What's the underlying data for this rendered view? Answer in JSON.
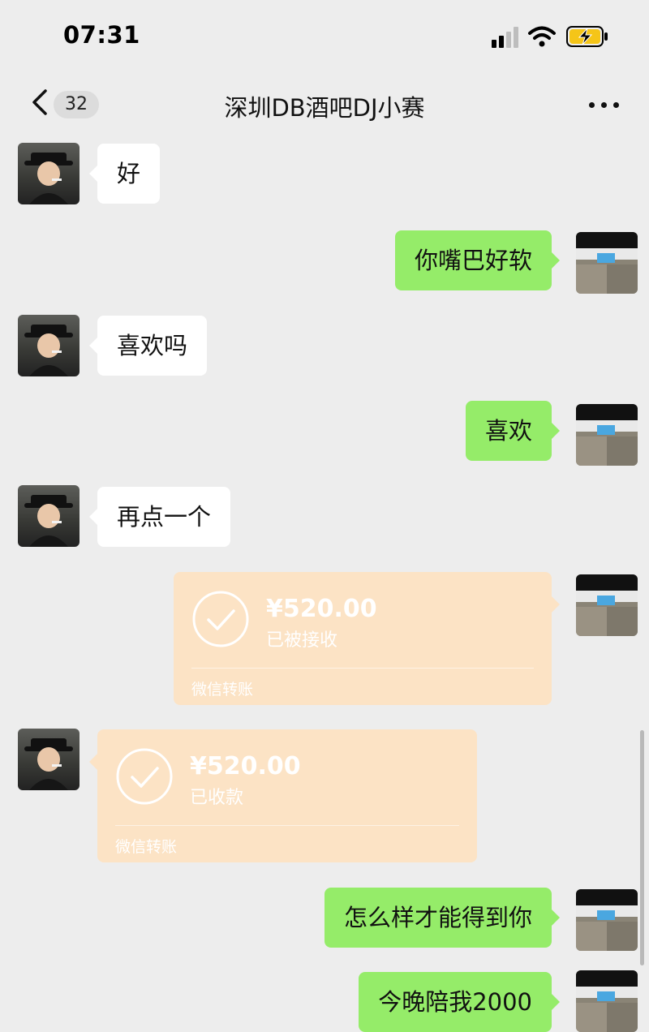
{
  "status_bar": {
    "time": "07:31"
  },
  "nav": {
    "unread_count": "32",
    "title": "深圳DB酒吧DJ小赛"
  },
  "messages": [
    {
      "side": "left",
      "type": "text",
      "text": "好"
    },
    {
      "side": "right",
      "type": "text",
      "text": "你嘴巴好软"
    },
    {
      "side": "left",
      "type": "text",
      "text": "喜欢吗"
    },
    {
      "side": "right",
      "type": "text",
      "text": "喜欢"
    },
    {
      "side": "left",
      "type": "text",
      "text": "再点一个"
    },
    {
      "side": "right",
      "type": "transfer",
      "amount": "¥520.00",
      "status": "已被接收",
      "footer": "微信转账"
    },
    {
      "side": "left",
      "type": "transfer",
      "amount": "¥520.00",
      "status": "已收款",
      "footer": "微信转账"
    },
    {
      "side": "right",
      "type": "text",
      "text": "怎么样才能得到你"
    },
    {
      "side": "right",
      "type": "text",
      "text": "今晚陪我2000"
    }
  ],
  "colors": {
    "background": "#ededed",
    "bubble_sent": "#95ec69",
    "bubble_received": "#ffffff",
    "transfer_card": "#fce3c5"
  },
  "icons": {
    "back": "chevron-left-icon",
    "more": "more-dots-icon",
    "wifi": "wifi-icon",
    "battery": "battery-charging-icon",
    "signal": "signal-bars-icon",
    "transfer": "check-circle-icon"
  }
}
